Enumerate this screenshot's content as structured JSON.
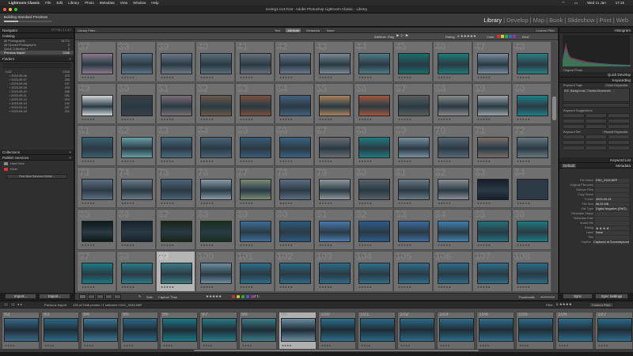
{
  "menubar": {
    "items": [
      "Lightroom Classic",
      "File",
      "Edit",
      "Library",
      "Photo",
      "Metadata",
      "View",
      "Window",
      "Help"
    ],
    "right_date": "Wed 11 Jan",
    "right_time": "17:16"
  },
  "window": {
    "title": "Iceimg1-v13.lrcat - Adobe Photoshop Lightroom Classic - Library"
  },
  "identity": {
    "status": "Building Standard Previews",
    "progress": 0.3
  },
  "modules": [
    "Library",
    "Develop",
    "Map",
    "Book",
    "Slideshow",
    "Print",
    "Web"
  ],
  "active_module": "Library",
  "left_panel": {
    "navigator": "Navigator",
    "catalog": "Catalog",
    "catalog_items": [
      {
        "label": "All Photographs",
        "count": "51771"
      },
      {
        "label": "All Synced Photographs",
        "count": "0"
      },
      {
        "label": "Quick Collection +",
        "count": "0"
      },
      {
        "label": "Previous Import",
        "count": "2346"
      }
    ],
    "folders": "Folders",
    "folder_items": [
      {
        "label": "ICE",
        "count": "2346"
      },
      {
        "label": "2023-09-06",
        "count": "223"
      },
      {
        "label": "2023-09-07",
        "count": "265"
      },
      {
        "label": "2023-09-08",
        "count": "237"
      },
      {
        "label": "2023-09-09",
        "count": "204"
      },
      {
        "label": "2023-09-10",
        "count": "266"
      },
      {
        "label": "2023-09-11",
        "count": "231"
      },
      {
        "label": "2023-09-12",
        "count": "219"
      },
      {
        "label": "2023-09-13",
        "count": "242"
      },
      {
        "label": "2023-09-14",
        "count": "237"
      },
      {
        "label": "2023-09-15",
        "count": "222"
      }
    ],
    "collections": "Collections",
    "publish_services": "Publish Services",
    "publish_items": [
      "Hard Drive",
      "Flickr"
    ],
    "find_more": "Find More Services Online...",
    "import_label": "Import...",
    "export_label": "Export..."
  },
  "filter_bar": {
    "title": "Library Filter :",
    "options": [
      "Text",
      "Attribute",
      "Metadata",
      "None"
    ],
    "active": "Attribute",
    "right": "Custom Filter"
  },
  "attribute_bar": {
    "attribute_label": "Attribute",
    "flag_label": "Flag",
    "rating_label": "Rating",
    "color_label": "Color",
    "kind_label": "Kind"
  },
  "grid": {
    "rows": [
      {
        "start": 37,
        "colors": [
          "#8a7a8c",
          "#5d7388",
          "#6d7a8a",
          "#5b6f7a",
          "#6b6f7a",
          "#6b7a8c",
          "#7a8a96",
          "#4f7c86",
          "#176f6a",
          "#1c7a76",
          "#7a8c9e",
          "#2a7f84"
        ]
      },
      {
        "start": 49,
        "colors": [
          "#d0d4d6",
          "#3a3f44",
          "#7c6e74",
          "#6a5a4a",
          "#7a5040",
          "#44617c",
          "#a8825c",
          "#a0583c",
          "#5a5f5c",
          "#8a8a88",
          "#9aa2a8",
          "#1f8088"
        ]
      },
      {
        "start": 61,
        "colors": [
          "#3c6070",
          "#68a0a8",
          "#4c6c80",
          "#4a6478",
          "#3c5c78",
          "#3c6282",
          "#6a6c70",
          "#1d7c7e",
          "#7890a0",
          "#5a6878",
          "#7a6e6a",
          "#6a7880"
        ]
      },
      {
        "start": 73,
        "colors": [
          "#5c7080",
          "#6c7c88",
          "#4c6478",
          "#8a9aa8",
          "#7a8c78",
          "#5c6e82",
          "#90989c",
          "#5a6066",
          "#6a7a86",
          "#8a8e92",
          "#1a1c2c",
          "#2e3a48"
        ]
      },
      {
        "start": 85,
        "colors": [
          "#0e1a18",
          "#18222a",
          "#1a2418",
          "#18301e",
          "#3c6e98",
          "#2c5a80",
          "#4a7ab0",
          "#2c5a8c",
          "#3c6a9c",
          "#4080b0",
          "#24707c",
          "#1c7a82"
        ]
      },
      {
        "start": 97,
        "colors": [
          "#1a7a84",
          "#287c86",
          "#3c7c86",
          "#6c8ea0",
          "#2c6e8a",
          "#2a6a86",
          "#2c6c88",
          "#2e6e8a",
          "#306e8c",
          "#2e6c8a",
          "#2e6e8a",
          "#2c6c88"
        ]
      }
    ],
    "selected": 99
  },
  "toolbar": {
    "sort_label": "Sort:",
    "sort_value": "Capture Time",
    "thumbnails_label": "Thumbnails"
  },
  "filmstrip_bar": {
    "source": "Previous Import",
    "count_text": "125 of 2346 photos / 1 selected / DSC_0345.NEF",
    "filter_label": "Filter :",
    "filter_value": "Custom Filter"
  },
  "filmstrip": [
    {
      "num": "92",
      "color": "#3c6a8a"
    },
    {
      "num": "93",
      "color": "#2c6a86"
    },
    {
      "num": "94",
      "color": "#3c7a98"
    },
    {
      "num": "95",
      "color": "#2c6a86"
    },
    {
      "num": "96",
      "color": "#1a7a84"
    },
    {
      "num": "97",
      "color": "#287c86"
    },
    {
      "num": "98",
      "color": "#3c7c86"
    },
    {
      "num": "99",
      "color": "#6c8ea0"
    },
    {
      "num": "100",
      "color": "#2c6e8a"
    },
    {
      "num": "101",
      "color": "#2a6a86"
    },
    {
      "num": "102",
      "color": "#2c6c88"
    },
    {
      "num": "103",
      "color": "#2e6e8a"
    },
    {
      "num": "104",
      "color": "#306e8c"
    },
    {
      "num": "105",
      "color": "#2e6c8a"
    },
    {
      "num": "106",
      "color": "#2e6e8a"
    },
    {
      "num": "107",
      "color": "#2c6c88"
    }
  ],
  "right_panel": {
    "histogram": "Histogram",
    "original_photo": "Original Photo",
    "quick_develop": "Quick Develop",
    "keywording": "Keywording",
    "keyword_tags_label": "Keyword Tags",
    "keyword_tags_value": "Enter Keywords",
    "keywords_text": "ICE, Background, Chantal Abramovitz, ...",
    "keyword_suggestions": "Keyword Suggestions",
    "keyword_set": "Keyword Set",
    "keyword_set_value": "Recent Keywords",
    "keyword_list": "Keyword List",
    "metadata": "Metadata",
    "metadata_preset": "Default",
    "fields": [
      {
        "label": "File Name",
        "value": "DSC_0345.NEF"
      },
      {
        "label": "Original Filename",
        "value": ""
      },
      {
        "label": "Sidecar Files",
        "value": ""
      },
      {
        "label": "Copy Name",
        "value": ""
      },
      {
        "label": "Folder",
        "value": "2023-09-13"
      },
      {
        "label": "File Size",
        "value": "56.59 MB"
      },
      {
        "label": "File Type",
        "value": "Digital Negative (DNG)"
      },
      {
        "label": "Metadata Status",
        "value": ""
      },
      {
        "label": "Metadata Date",
        "value": ""
      },
      {
        "label": "Audio File",
        "value": ""
      },
      {
        "label": "Rating",
        "value": "★ ★ ★ ★"
      },
      {
        "label": "Label",
        "value": "None"
      },
      {
        "label": "Title",
        "value": ""
      },
      {
        "label": "Caption",
        "value": "Captured at Scoresbysund"
      }
    ],
    "sync_label": "Sync",
    "sync_settings_label": "Sync Settings"
  }
}
